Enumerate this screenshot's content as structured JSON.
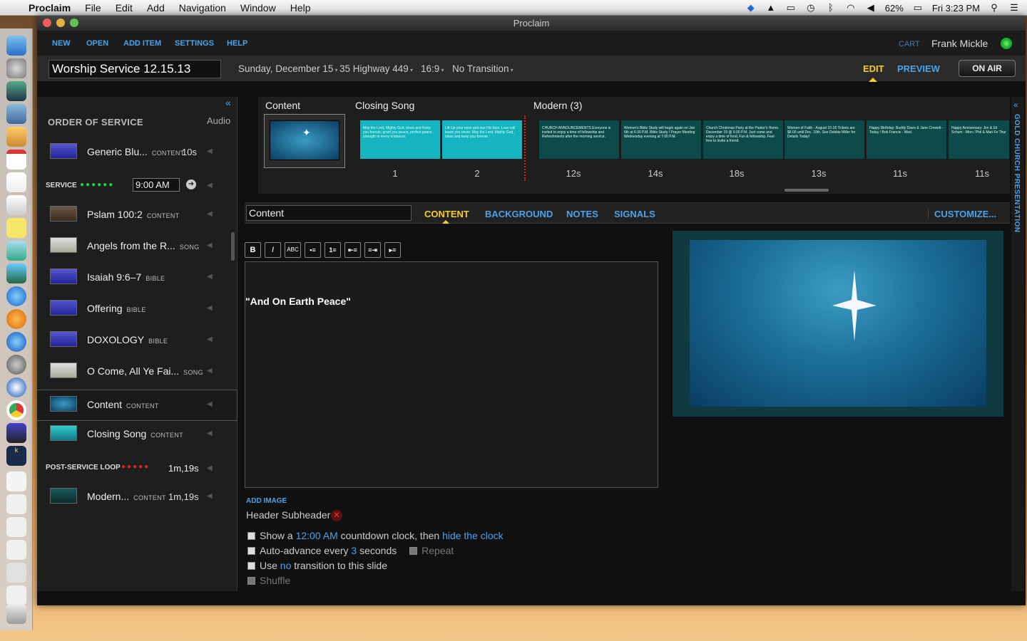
{
  "menubar": {
    "app_name": "Proclaim",
    "items": [
      "File",
      "Edit",
      "Add",
      "Navigation",
      "Window",
      "Help"
    ],
    "battery": "62%",
    "clock": "Fri 3:23 PM"
  },
  "window": {
    "title": "Proclaim"
  },
  "topnav": {
    "items": [
      "NEW",
      "OPEN",
      "ADD ITEM",
      "SETTINGS",
      "HELP"
    ],
    "cart": "CART",
    "user": "Frank Mickle"
  },
  "service_bar": {
    "title": "Worship Service 12.15.13",
    "date": "Sunday, December 15",
    "location": "35 Highway 449",
    "aspect": "16:9",
    "transition": "No Transition",
    "edit": "EDIT",
    "preview": "PREVIEW",
    "on_air": "ON AIR"
  },
  "order": {
    "title": "ORDER OF SERVICE",
    "audio": "Audio",
    "items": [
      {
        "name": "Generic Blu...",
        "type": "CONTENT",
        "dur": "10s"
      },
      {
        "name": "Pslam 100:2",
        "type": "CONTENT",
        "dur": ""
      },
      {
        "name": "Angels from the R...",
        "type": "SONG",
        "dur": ""
      },
      {
        "name": "Isaiah 9:6–7",
        "type": "BIBLE",
        "dur": ""
      },
      {
        "name": "Offering",
        "type": "BIBLE",
        "dur": ""
      },
      {
        "name": "DOXOLOGY",
        "type": "BIBLE",
        "dur": ""
      },
      {
        "name": "O Come, All Ye Fai...",
        "type": "SONG",
        "dur": ""
      },
      {
        "name": "Content",
        "type": "CONTENT",
        "dur": ""
      },
      {
        "name": "Closing Song",
        "type": "CONTENT",
        "dur": ""
      },
      {
        "name": "Modern...",
        "type": "CONTENT",
        "dur": "1m,19s"
      }
    ],
    "service_label": "SERVICE",
    "service_time": "9:00 AM",
    "post_label": "POST-SERVICE LOOP",
    "post_time": "1m,19s"
  },
  "strip": {
    "groups": [
      "Content",
      "Closing Song",
      "Modern (3)"
    ],
    "slides": [
      {
        "text": "May the Lord, Mighty God, bless and Keep you forever, grant you peace, perfect peace, strength in every endeavor.",
        "label": "1"
      },
      {
        "text": "Lift Up your eyes and see His face. Love will leave you never. May the Lord, Mighty God, bless and keep you forever.",
        "label": "2"
      },
      {
        "text": "CHURCH ANNOUNCEMENTS Everyone is invited to enjoy a time of fellowship and Refreshments after the morning service.",
        "label": "12s"
      },
      {
        "text": "Women's Bible Study will begin again on Jan 6th at 6:30 P.M. Bible Study / Prayer Meeting Wednesday evening at 7:00 P.M.",
        "label": "14s"
      },
      {
        "text": "Church Christmas Party at the Pastor's Home. December 19 @ 6:00 P.M. Just come and enjoy a time of food, Fun & fellowship. Feel free to invite a friend.",
        "label": "18s"
      },
      {
        "text": "Women of Faith - August 15-16 Tickets are $8.00 until Dec. 19th. See Debbie Miller for Details Today!",
        "label": "13s"
      },
      {
        "text": "Happy Birthday: Buddy Davis & Jane Crowell - Today / Bob Francis - Wed.",
        "label": "11s"
      },
      {
        "text": "Happy Anniversary: Jim & Eli Schum - Mon / Phil & Mari Fe Thur",
        "label": "11s"
      }
    ]
  },
  "editor": {
    "slide_name": "Content",
    "tabs": [
      "CONTENT",
      "BACKGROUND",
      "NOTES",
      "SIGNALS"
    ],
    "customize": "CUSTOMIZE...",
    "format_buttons": [
      "B",
      "I",
      "ABC",
      "•≡",
      "1≡",
      "⇤≡",
      "≡⇥",
      "▸≡"
    ],
    "body_text": "\"And On Earth Peace\"",
    "add_image": "ADD IMAGE",
    "header_sub": "Header Subheader",
    "opt1": {
      "a": "Show a",
      "b": "12:00 AM",
      "c": "countdown clock, then",
      "d": "hide the clock"
    },
    "opt2": {
      "a": "Auto-advance every",
      "b": "3",
      "c": "seconds",
      "d": "Repeat"
    },
    "opt3": {
      "a": "Use",
      "b": "no",
      "c": "transition to this slide"
    },
    "opt4": "Shuffle"
  },
  "vtab": "GOLD CHURCH PRESENTATION",
  "colors": {
    "accent": "#4aa3e8",
    "active": "#f5d020",
    "green": "#22cc44",
    "red": "#dd2222"
  }
}
